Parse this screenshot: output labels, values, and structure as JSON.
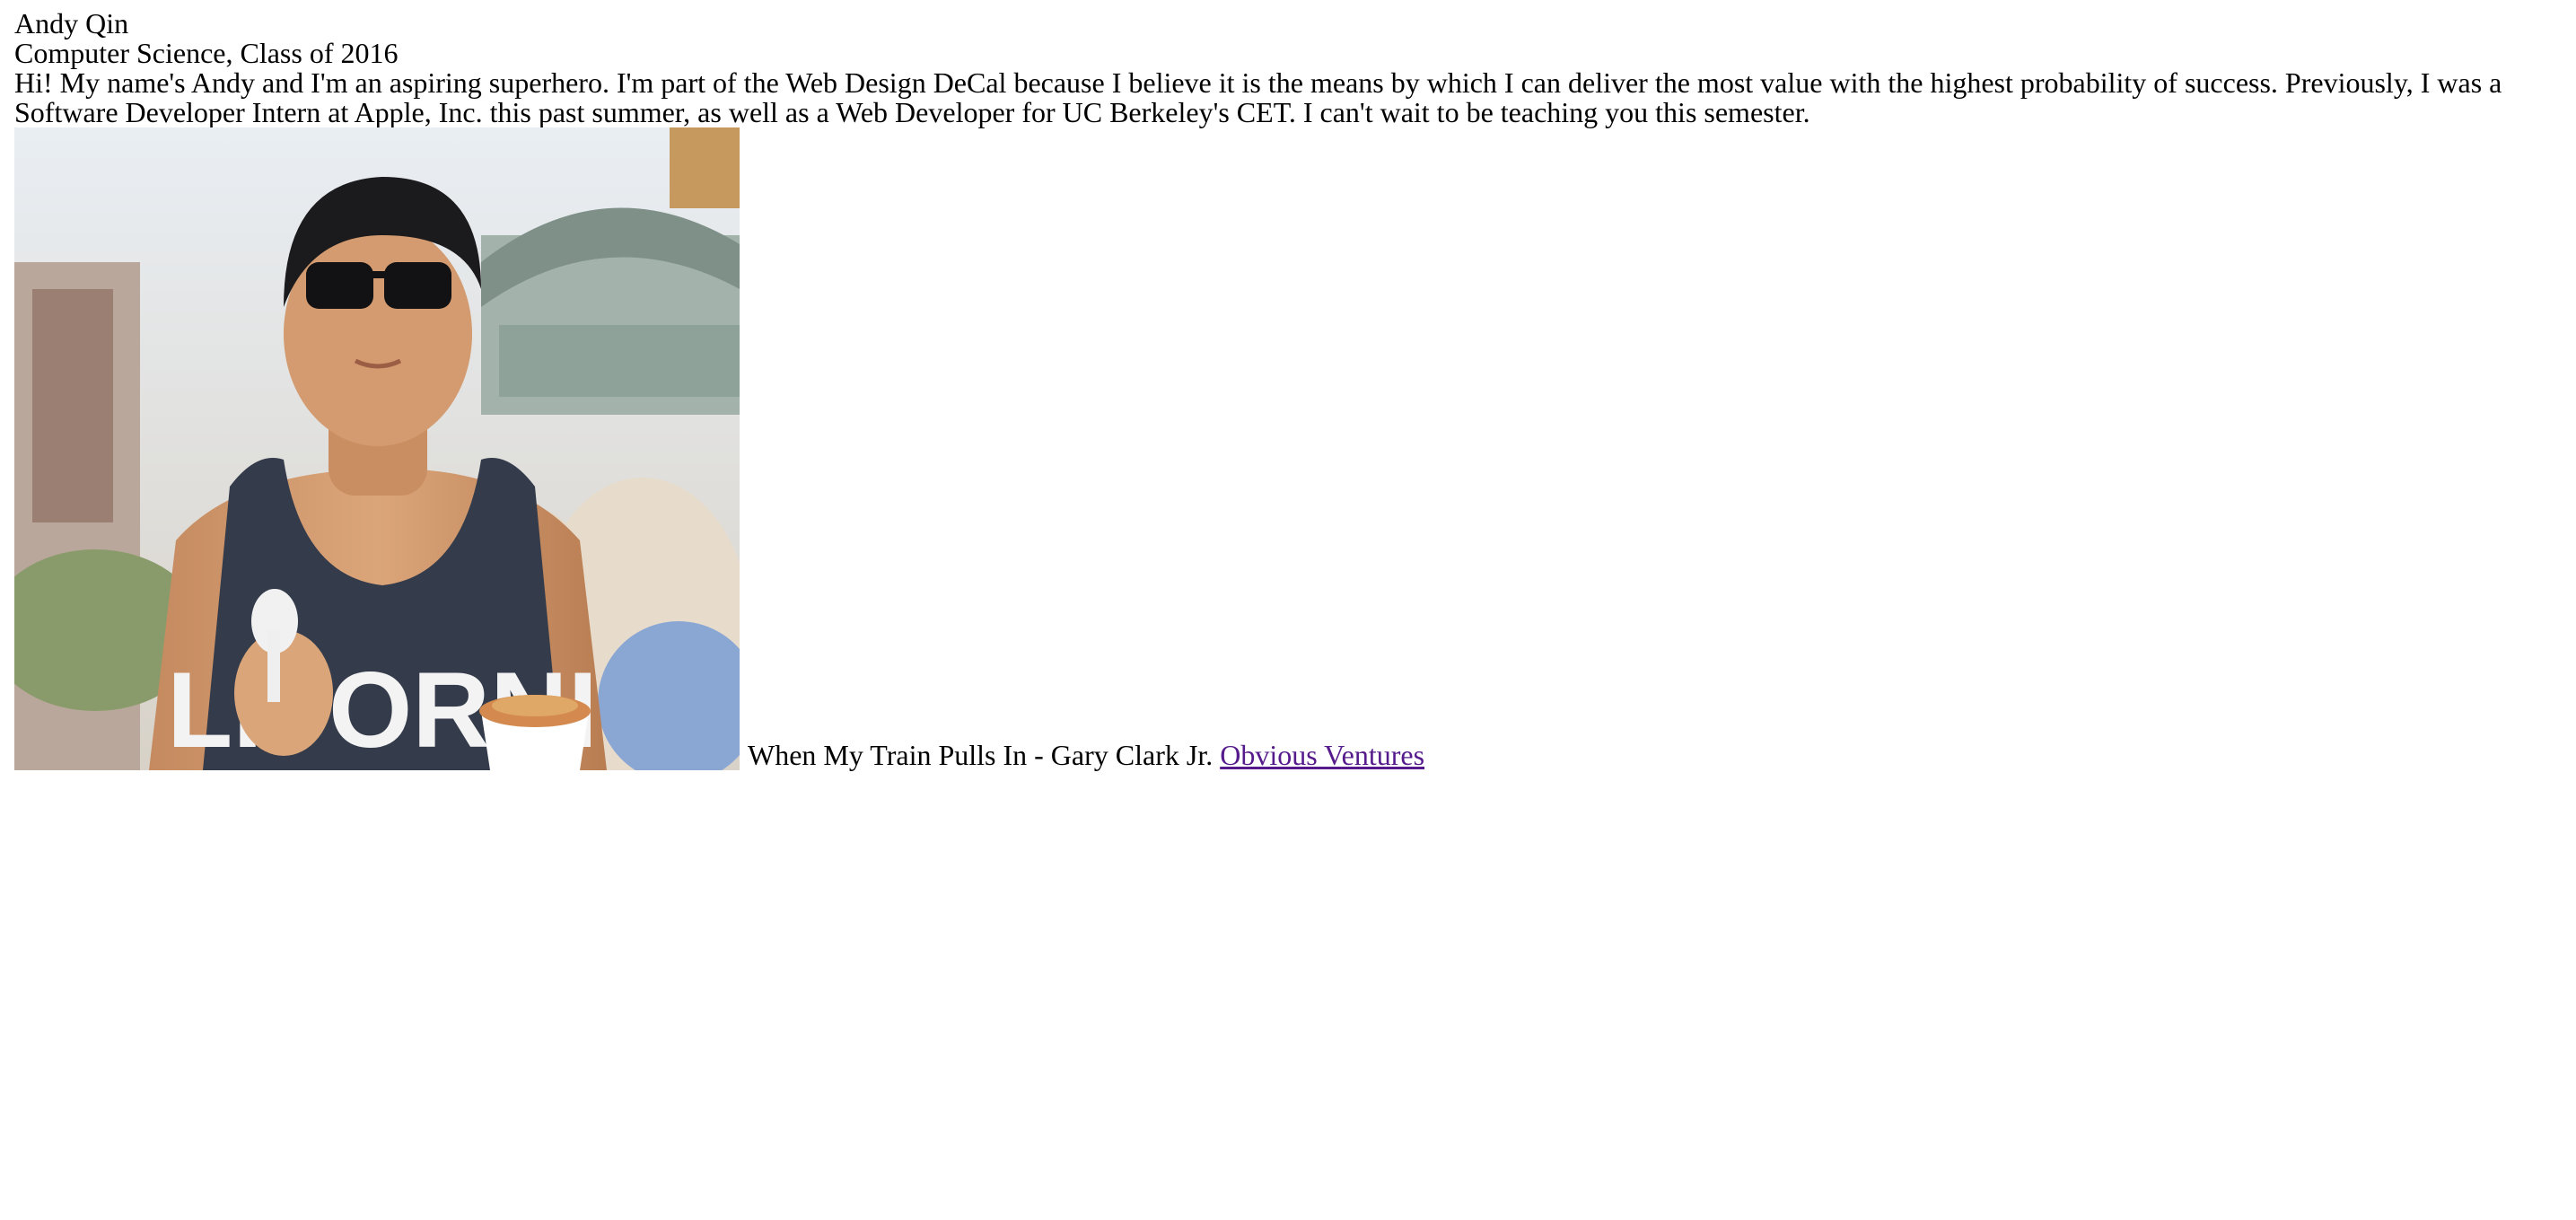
{
  "profile": {
    "name": "Andy Qin",
    "major_line": "Computer Science, Class of 2016",
    "bio": "Hi! My name's Andy and I'm an aspiring superhero. I'm part of the Web Design DeCal because I believe it is the means by which I can deliver the most value with the highest probability of success. Previously, I was a Software Developer Intern at Apple, Inc. this past summer, as well as a Web Developer for UC Berkeley's CET. I can't wait to be teaching you this semester.",
    "photo_shirt_text": "LIFORNI",
    "song_text": "When My Train Pulls In - Gary Clark Jr.",
    "link_text": "Obvious Ventures"
  },
  "colors": {
    "link_visited": "#551a8b",
    "text": "#000000",
    "background": "#ffffff"
  }
}
